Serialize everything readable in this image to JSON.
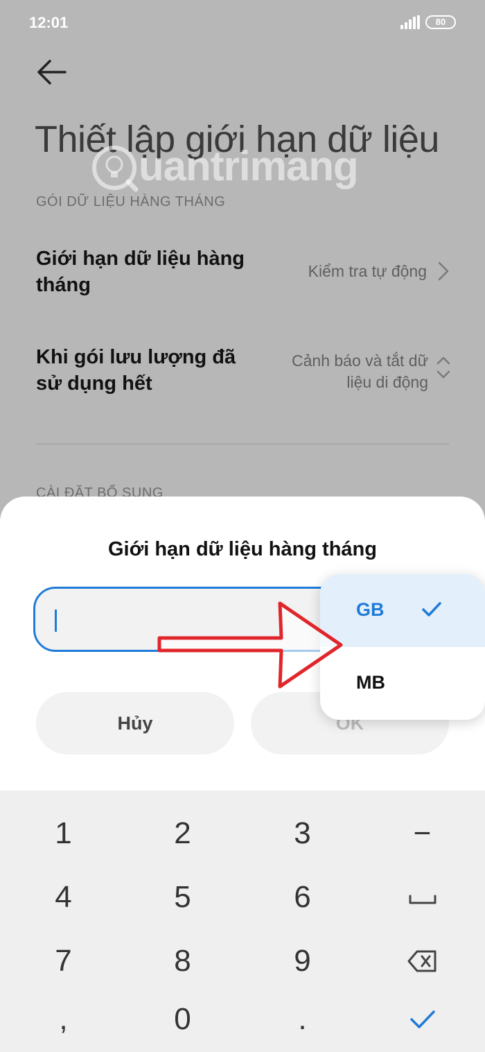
{
  "status_bar": {
    "time": "12:01",
    "battery": "80"
  },
  "page": {
    "title": "Thiết lập giới hạn dữ liệu",
    "watermark": "uantrimang",
    "section_monthly": "GÓI DỮ LIỆU HÀNG THÁNG",
    "rows": [
      {
        "title": "Giới hạn dữ liệu hàng tháng",
        "value": "Kiểm tra tự động"
      },
      {
        "title": "Khi gói lưu lượng đã sử dụng hết",
        "value_line1": "Cảnh báo và tắt dữ",
        "value_line2": "liệu di động"
      }
    ],
    "section_additional": "CÀI ĐẶT BỔ SUNG"
  },
  "dialog": {
    "title": "Giới hạn dữ liệu hàng tháng",
    "input_value": "",
    "cancel_label": "Hủy",
    "ok_label": "OK"
  },
  "unit_menu": {
    "options": [
      {
        "label": "GB",
        "selected": true
      },
      {
        "label": "MB",
        "selected": false
      }
    ]
  },
  "colors": {
    "accent": "#1f7bd8",
    "annotation_arrow": "#e0262b",
    "scrim": "#b7b7b7"
  },
  "keyboard": {
    "keys": [
      "1",
      "2",
      "3",
      "−",
      "4",
      "5",
      "6",
      "space-icon",
      "7",
      "8",
      "9",
      "backspace-icon",
      ",",
      "0",
      ".",
      "done-check-icon"
    ]
  }
}
